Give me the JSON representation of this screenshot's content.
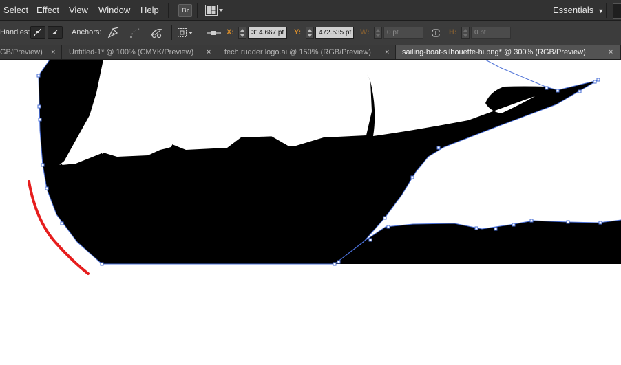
{
  "menubar": {
    "items": [
      "Select",
      "Effect",
      "View",
      "Window",
      "Help"
    ],
    "bridge_label": "Br",
    "workspace": "Essentials"
  },
  "controlbar": {
    "handles_label": "Handles:",
    "anchors_label": "Anchors:",
    "x_label": "X:",
    "x_value": "314.667 pt",
    "y_label": "Y:",
    "y_value": "472.535 pt",
    "w_label": "W:",
    "w_value": "0 pt",
    "h_label": "H:",
    "h_value": "0 pt"
  },
  "tabs": [
    {
      "label": "GB/Preview)",
      "close": "×"
    },
    {
      "label": "Untitled-1* @ 100% (CMYK/Preview)",
      "close": "×"
    },
    {
      "label": "tech rudder logo.ai @ 150% (RGB/Preview)",
      "close": "×"
    },
    {
      "label": "sailing-boat-silhouette-hi.png* @ 300% (RGB/Preview)",
      "close": "×",
      "active": true
    }
  ],
  "colors": {
    "ui_dark": "#323232",
    "control_bg": "#3c3c3c",
    "accent_orange": "#d48b2c",
    "path_blue": "#4a6fd6",
    "annotation_red": "#e61e1e"
  },
  "icons": {
    "layout": "arrange-documents-icon",
    "anchor_pen": "pen-add-anchor-icon",
    "anchor_convert": "convert-anchor-icon",
    "anchor_cut": "cut-path-icon",
    "transform": "transform-icon",
    "align": "align-icon",
    "link": "constrain-proportions-icon"
  }
}
